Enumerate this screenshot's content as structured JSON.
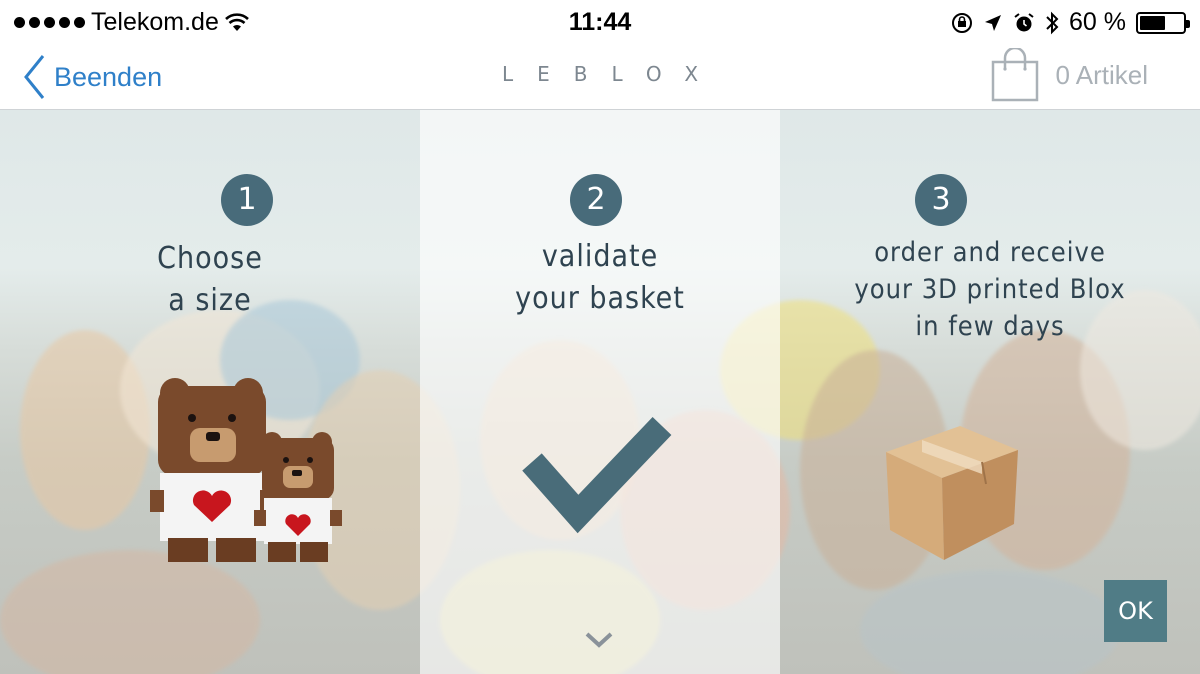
{
  "status_bar": {
    "carrier": "Telekom.de",
    "time": "11:44",
    "battery_text": "60 %",
    "battery_level": 0.6
  },
  "nav": {
    "back_label": "Beenden",
    "brand": "LEBLOX",
    "cart_label": "0 Artikel"
  },
  "steps": [
    {
      "number": "1",
      "lines": [
        "Choose",
        "a size"
      ],
      "icon": "teddy-bears-icon"
    },
    {
      "number": "2",
      "lines": [
        "validate",
        "your basket"
      ],
      "icon": "checkmark-icon"
    },
    {
      "number": "3",
      "lines": [
        "order and receive",
        "your 3D printed Blox",
        "in few days"
      ],
      "icon": "cardboard-box-icon"
    }
  ],
  "ok_label": "OK",
  "colors": {
    "accent": "#486b7a",
    "ok_button": "#507c86",
    "link": "#2f80c9"
  }
}
